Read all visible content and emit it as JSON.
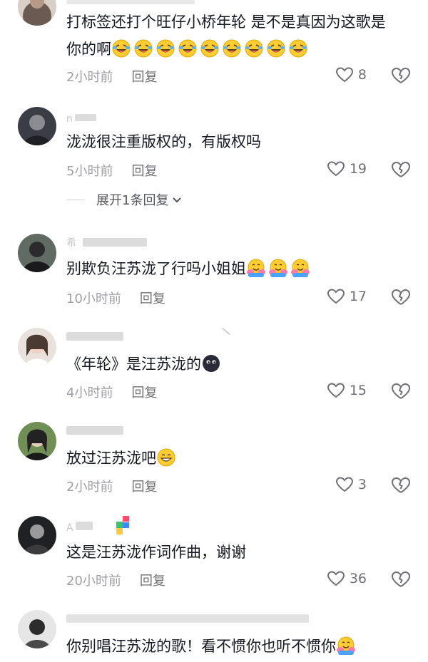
{
  "comments": [
    {
      "id": "c1",
      "text": "打标签还打个旺仔小桥年轮 是不是真因为这歌是",
      "text2": "你的啊",
      "emoji_count": 9,
      "emoji_name": "laughing-crying-emoji",
      "time": "2小时前",
      "reply": "回复",
      "likes": "8"
    },
    {
      "id": "c2",
      "username": "n",
      "text": "泷泷很注重版权的，有版权吗",
      "time": "5小时前",
      "reply": "回复",
      "likes": "19",
      "expand": "展开1条回复"
    },
    {
      "id": "c3",
      "username": "希",
      "text": "别欺负汪苏泷了行吗小姐姐",
      "emoji_count": 3,
      "emoji_name": "hugging-emoji",
      "time": "10小时前",
      "reply": "回复",
      "likes": "17"
    },
    {
      "id": "c4",
      "username": "",
      "text": "《年轮》是汪苏泷的",
      "emoji_count": 1,
      "emoji_name": "dark-face-emoji",
      "time": "4小时前",
      "reply": "回复",
      "likes": "15"
    },
    {
      "id": "c5",
      "username": "",
      "text": "放过汪苏泷吧",
      "emoji_count": 1,
      "emoji_name": "grinning-emoji",
      "time": "2小时前",
      "reply": "回复",
      "likes": "3"
    },
    {
      "id": "c6",
      "username": "A",
      "text": "这是汪苏泷作词作曲，谢谢",
      "time": "20小时前",
      "reply": "回复",
      "likes": "36"
    },
    {
      "id": "c7",
      "username": "",
      "text": "你别唱汪苏泷的歌！看不惯你也听不惯你",
      "emoji_count": 1,
      "emoji_name": "hugging-emoji"
    }
  ],
  "colors": {
    "text": "#161823",
    "meta": "#a0a0a8",
    "reply": "#6f6f78",
    "emoji_yellow": "#ffcc33"
  }
}
